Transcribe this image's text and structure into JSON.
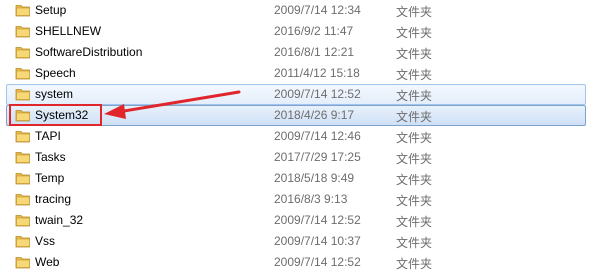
{
  "files": [
    {
      "name": "Setup",
      "date": "2009/7/14 12:34",
      "type": "文件夹",
      "state": ""
    },
    {
      "name": "SHELLNEW",
      "date": "2016/9/2 11:47",
      "type": "文件夹",
      "state": ""
    },
    {
      "name": "SoftwareDistribution",
      "date": "2016/8/1 12:21",
      "type": "文件夹",
      "state": ""
    },
    {
      "name": "Speech",
      "date": "2011/4/12 15:18",
      "type": "文件夹",
      "state": ""
    },
    {
      "name": "system",
      "date": "2009/7/14 12:52",
      "type": "文件夹",
      "state": "hover"
    },
    {
      "name": "System32",
      "date": "2018/4/26 9:17",
      "type": "文件夹",
      "state": "selected"
    },
    {
      "name": "TAPI",
      "date": "2009/7/14 12:46",
      "type": "文件夹",
      "state": ""
    },
    {
      "name": "Tasks",
      "date": "2017/7/29 17:25",
      "type": "文件夹",
      "state": ""
    },
    {
      "name": "Temp",
      "date": "2018/5/18 9:49",
      "type": "文件夹",
      "state": ""
    },
    {
      "name": "tracing",
      "date": "2016/8/3 9:13",
      "type": "文件夹",
      "state": ""
    },
    {
      "name": "twain_32",
      "date": "2009/7/14 12:52",
      "type": "文件夹",
      "state": ""
    },
    {
      "name": "Vss",
      "date": "2009/7/14 10:37",
      "type": "文件夹",
      "state": ""
    },
    {
      "name": "Web",
      "date": "2009/7/14 12:52",
      "type": "文件夹",
      "state": ""
    }
  ],
  "annotation": {
    "color": "#e0262a",
    "target": "System32"
  },
  "icons": {
    "folder": "folder-icon"
  }
}
